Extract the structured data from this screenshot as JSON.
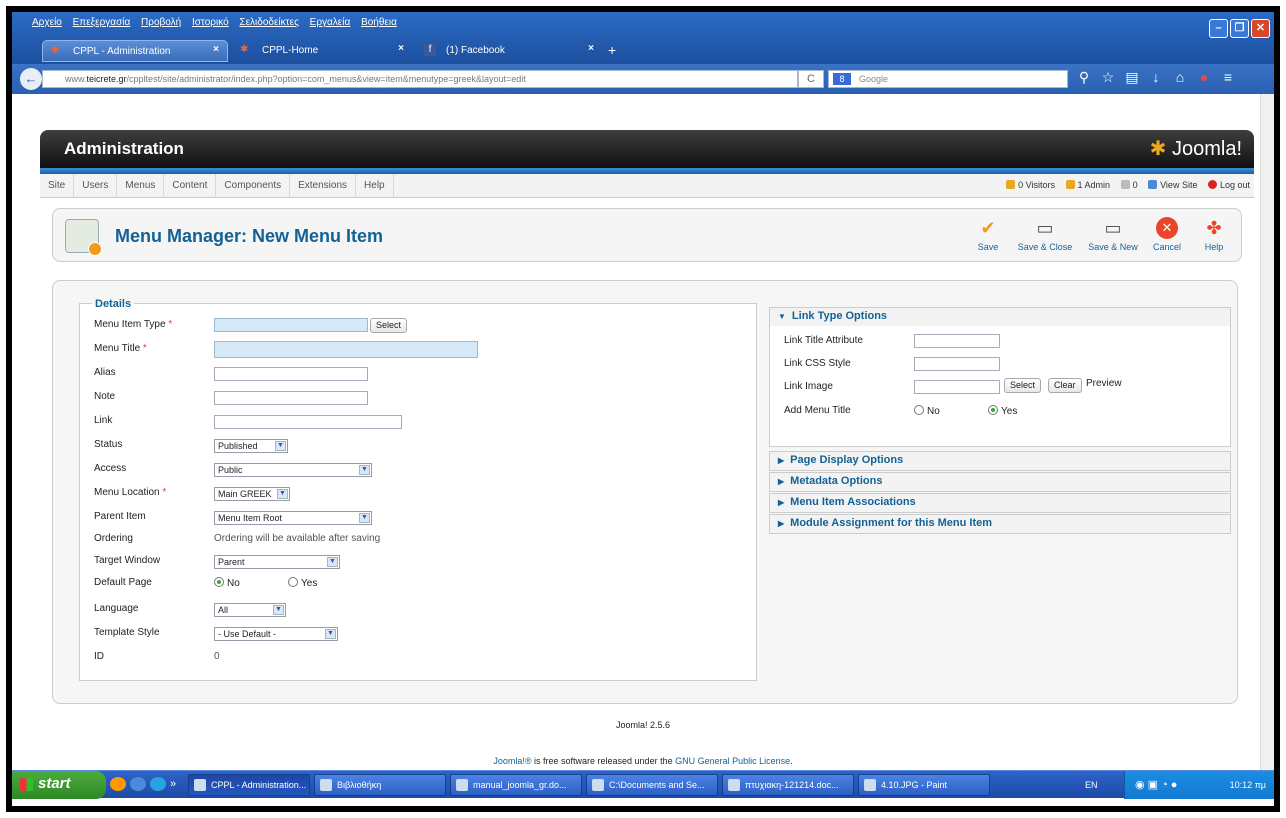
{
  "browser": {
    "menu": [
      "Αρχείο",
      "Επεξεργασία",
      "Προβολή",
      "Ιστορικό",
      "Σελιδοδείκτες",
      "Εργαλεία",
      "Βοήθεια"
    ],
    "tabs": [
      "CPPL - Administration",
      "CPPL-Home",
      "(1) Facebook"
    ],
    "url_prefix": "www.",
    "url_domain": "teicrete.gr",
    "url_rest": "/cppltest/site/administrator/index.php?option=com_menus&view=item&menutype=greek&layout=edit",
    "search_placeholder": "Google"
  },
  "admin": {
    "header_title": "Administration",
    "logo_text": "Joomla!",
    "nav": [
      "Site",
      "Users",
      "Menus",
      "Content",
      "Components",
      "Extensions",
      "Help"
    ],
    "status": {
      "visitors": "0 Visitors",
      "admins": "1 Admin",
      "messages": "0",
      "view_site": "View Site",
      "logout": "Log out"
    },
    "page_title": "Menu Manager: New Menu Item",
    "toolbar": {
      "save": "Save",
      "save_close": "Save & Close",
      "save_new": "Save & New",
      "cancel": "Cancel",
      "help": "Help"
    }
  },
  "details": {
    "legend": "Details",
    "menu_item_type": {
      "label": "Menu Item Type",
      "value": "",
      "button": "Select"
    },
    "menu_title": {
      "label": "Menu Title",
      "value": ""
    },
    "alias": {
      "label": "Alias",
      "value": ""
    },
    "note": {
      "label": "Note",
      "value": ""
    },
    "link": {
      "label": "Link",
      "value": ""
    },
    "status": {
      "label": "Status",
      "value": "Published"
    },
    "access": {
      "label": "Access",
      "value": "Public"
    },
    "menu_location": {
      "label": "Menu Location",
      "value": "Main GREEK"
    },
    "parent_item": {
      "label": "Parent Item",
      "value": "Menu Item Root"
    },
    "ordering": {
      "label": "Ordering",
      "value": "Ordering will be available after saving"
    },
    "target_window": {
      "label": "Target Window",
      "value": "Parent"
    },
    "default_page": {
      "label": "Default Page",
      "no": "No",
      "yes": "Yes",
      "selected": "No"
    },
    "language": {
      "label": "Language",
      "value": "All"
    },
    "template_style": {
      "label": "Template Style",
      "value": "- Use Default -"
    },
    "id": {
      "label": "ID",
      "value": "0"
    },
    "required_mark": "*"
  },
  "link_type": {
    "title": "Link Type Options",
    "title_attribute": "Link Title Attribute",
    "css_style": "Link CSS Style",
    "image": "Link Image",
    "image_select": "Select",
    "image_clear": "Clear",
    "image_preview": "Preview",
    "add_menu_title": "Add Menu Title",
    "no": "No",
    "yes": "Yes",
    "selected": "Yes"
  },
  "panels": [
    "Page Display Options",
    "Metadata Options",
    "Menu Item Associations",
    "Module Assignment for this Menu Item"
  ],
  "footer": {
    "version": "Joomla! 2.5.6",
    "license_lead": "Joomla!®",
    "license_mid": " is free software released under the ",
    "license_link": "GNU General Public License",
    "license_end": "."
  },
  "taskbar": {
    "start": "start",
    "items": [
      "CPPL - Administration...",
      "Βιβλιοθήκη",
      "manual_joomla_gr.do...",
      "C:\\Documents and Se...",
      "πτυχιακη-121214.doc...",
      "4.10.JPG - Paint"
    ],
    "lang": "EN",
    "time": "10:12 πμ"
  },
  "colors": {
    "accent": "#146295",
    "required_bg": "#d5e9f6",
    "header_dark": "#1a1a1a",
    "stripe": "#2a78c4"
  }
}
